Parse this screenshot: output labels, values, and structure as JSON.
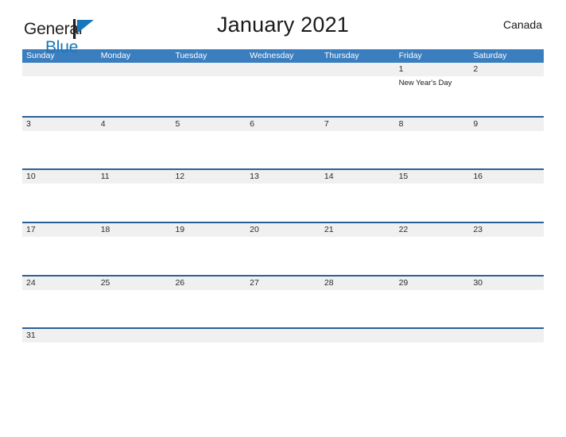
{
  "brand": {
    "word_one": "General",
    "word_two": "Blue",
    "mark_icon": "blue-triangle-flag-icon",
    "colors": {
      "dark": "#231f20",
      "blue": "#1877bc"
    }
  },
  "header": {
    "title": "January 2021",
    "country": "Canada"
  },
  "theme": {
    "header_blue": "#3b7ebf",
    "divider_blue": "#2a6099",
    "daynum_band_grey": "#f0f0f0"
  },
  "calendar": {
    "weekdays": [
      "Sunday",
      "Monday",
      "Tuesday",
      "Wednesday",
      "Thursday",
      "Friday",
      "Saturday"
    ],
    "weeks": [
      {
        "days": [
          {
            "num": "",
            "events": []
          },
          {
            "num": "",
            "events": []
          },
          {
            "num": "",
            "events": []
          },
          {
            "num": "",
            "events": []
          },
          {
            "num": "",
            "events": []
          },
          {
            "num": "1",
            "events": [
              "New Year's Day"
            ]
          },
          {
            "num": "2",
            "events": []
          }
        ]
      },
      {
        "days": [
          {
            "num": "3",
            "events": []
          },
          {
            "num": "4",
            "events": []
          },
          {
            "num": "5",
            "events": []
          },
          {
            "num": "6",
            "events": []
          },
          {
            "num": "7",
            "events": []
          },
          {
            "num": "8",
            "events": []
          },
          {
            "num": "9",
            "events": []
          }
        ]
      },
      {
        "days": [
          {
            "num": "10",
            "events": []
          },
          {
            "num": "11",
            "events": []
          },
          {
            "num": "12",
            "events": []
          },
          {
            "num": "13",
            "events": []
          },
          {
            "num": "14",
            "events": []
          },
          {
            "num": "15",
            "events": []
          },
          {
            "num": "16",
            "events": []
          }
        ]
      },
      {
        "days": [
          {
            "num": "17",
            "events": []
          },
          {
            "num": "18",
            "events": []
          },
          {
            "num": "19",
            "events": []
          },
          {
            "num": "20",
            "events": []
          },
          {
            "num": "21",
            "events": []
          },
          {
            "num": "22",
            "events": []
          },
          {
            "num": "23",
            "events": []
          }
        ]
      },
      {
        "days": [
          {
            "num": "24",
            "events": []
          },
          {
            "num": "25",
            "events": []
          },
          {
            "num": "26",
            "events": []
          },
          {
            "num": "27",
            "events": []
          },
          {
            "num": "28",
            "events": []
          },
          {
            "num": "29",
            "events": []
          },
          {
            "num": "30",
            "events": []
          }
        ]
      },
      {
        "days": [
          {
            "num": "31",
            "events": []
          },
          {
            "num": "",
            "events": []
          },
          {
            "num": "",
            "events": []
          },
          {
            "num": "",
            "events": []
          },
          {
            "num": "",
            "events": []
          },
          {
            "num": "",
            "events": []
          },
          {
            "num": "",
            "events": []
          }
        ]
      }
    ]
  }
}
